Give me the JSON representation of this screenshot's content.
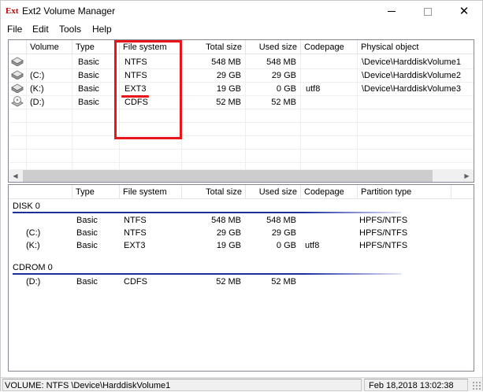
{
  "window": {
    "title": "Ext2 Volume Manager",
    "app_icon_text": "Ext",
    "minimize_icon": "minimize-icon",
    "maximize_icon": "maximize-icon",
    "close_icon": "close-icon",
    "close_glyph": "✕"
  },
  "menu": {
    "items": [
      {
        "label": "File"
      },
      {
        "label": "Edit"
      },
      {
        "label": "Tools"
      },
      {
        "label": "Help"
      }
    ]
  },
  "volumes": {
    "columns": [
      "Volume",
      "Type",
      "File system",
      "Total size",
      "Used size",
      "Codepage",
      "Physical object"
    ],
    "rows": [
      {
        "volume": "",
        "type": "Basic",
        "fs": "NTFS",
        "total": "548 MB",
        "used": "548 MB",
        "codepage": "",
        "object": "\\Device\\HarddiskVolume1",
        "icon": "hard-disk-icon"
      },
      {
        "volume": "(C:)",
        "type": "Basic",
        "fs": "NTFS",
        "total": "29 GB",
        "used": "29 GB",
        "codepage": "",
        "object": "\\Device\\HarddiskVolume2",
        "icon": "hard-disk-icon"
      },
      {
        "volume": "(K:)",
        "type": "Basic",
        "fs": "EXT3",
        "total": "19 GB",
        "used": "0 GB",
        "codepage": "utf8",
        "object": "\\Device\\HarddiskVolume3",
        "icon": "hard-disk-icon"
      },
      {
        "volume": "(D:)",
        "type": "Basic",
        "fs": "CDFS",
        "total": "52 MB",
        "used": "52 MB",
        "codepage": "",
        "object": "",
        "icon": "cdrom-icon"
      }
    ]
  },
  "disks": {
    "columns": [
      "",
      "Type",
      "File system",
      "Total size",
      "Used size",
      "Codepage",
      "Partition type"
    ],
    "groups": [
      {
        "name": "DISK 0",
        "rows": [
          {
            "volume": "",
            "type": "Basic",
            "fs": "NTFS",
            "total": "548 MB",
            "used": "548 MB",
            "codepage": "",
            "partition": "HPFS/NTFS"
          },
          {
            "volume": "(C:)",
            "type": "Basic",
            "fs": "NTFS",
            "total": "29 GB",
            "used": "29 GB",
            "codepage": "",
            "partition": "HPFS/NTFS"
          },
          {
            "volume": "(K:)",
            "type": "Basic",
            "fs": "EXT3",
            "total": "19 GB",
            "used": "0 GB",
            "codepage": "utf8",
            "partition": "HPFS/NTFS"
          }
        ]
      },
      {
        "name": "CDROM 0",
        "rows": [
          {
            "volume": "(D:)",
            "type": "Basic",
            "fs": "CDFS",
            "total": "52 MB",
            "used": "52 MB",
            "codepage": "",
            "partition": ""
          }
        ]
      }
    ]
  },
  "status": {
    "left": "VOLUME:  NTFS \\Device\\HarddiskVolume1",
    "right": "Feb 18,2018 13:02:38"
  },
  "annotation": {
    "color": "#e8161b"
  },
  "colors": {
    "group_line": "#1c2fa0",
    "accent_red": "#c00000"
  }
}
